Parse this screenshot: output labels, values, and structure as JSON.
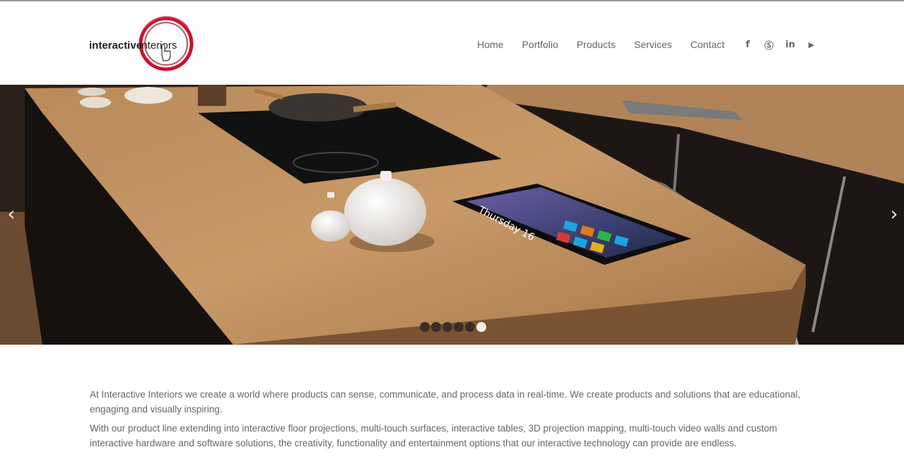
{
  "brand": {
    "name_bold": "interactive",
    "name_light": "interiors",
    "accent": "#c8102e"
  },
  "nav": {
    "items": [
      {
        "label": "Home"
      },
      {
        "label": "Portfolio"
      },
      {
        "label": "Products"
      },
      {
        "label": "Services"
      },
      {
        "label": "Contact"
      }
    ]
  },
  "social": [
    {
      "icon": "facebook-icon",
      "glyph": "f"
    },
    {
      "icon": "skype-icon",
      "glyph": "Ⓢ"
    },
    {
      "icon": "linkedin-icon",
      "glyph": "in"
    },
    {
      "icon": "youtube-icon",
      "glyph": "▶"
    }
  ],
  "slider": {
    "prev_glyph": "‹",
    "next_glyph": "›",
    "slide_count": 6,
    "active_index": 5,
    "tablet_text": "Thursday 16"
  },
  "content": {
    "paragraph_1": "At Interactive Interiors we create a world where products can sense, communicate, and process data in real-time. We create products and solutions that are educational, engaging and visually inspiring.",
    "paragraph_2": "With our product line extending into interactive floor projections, multi-touch surfaces, interactive tables, 3D projection mapping, multi-touch video walls and custom interactive hardware and software solutions, the creativity, functionality and entertainment options that our interactive technology can provide are endless."
  }
}
